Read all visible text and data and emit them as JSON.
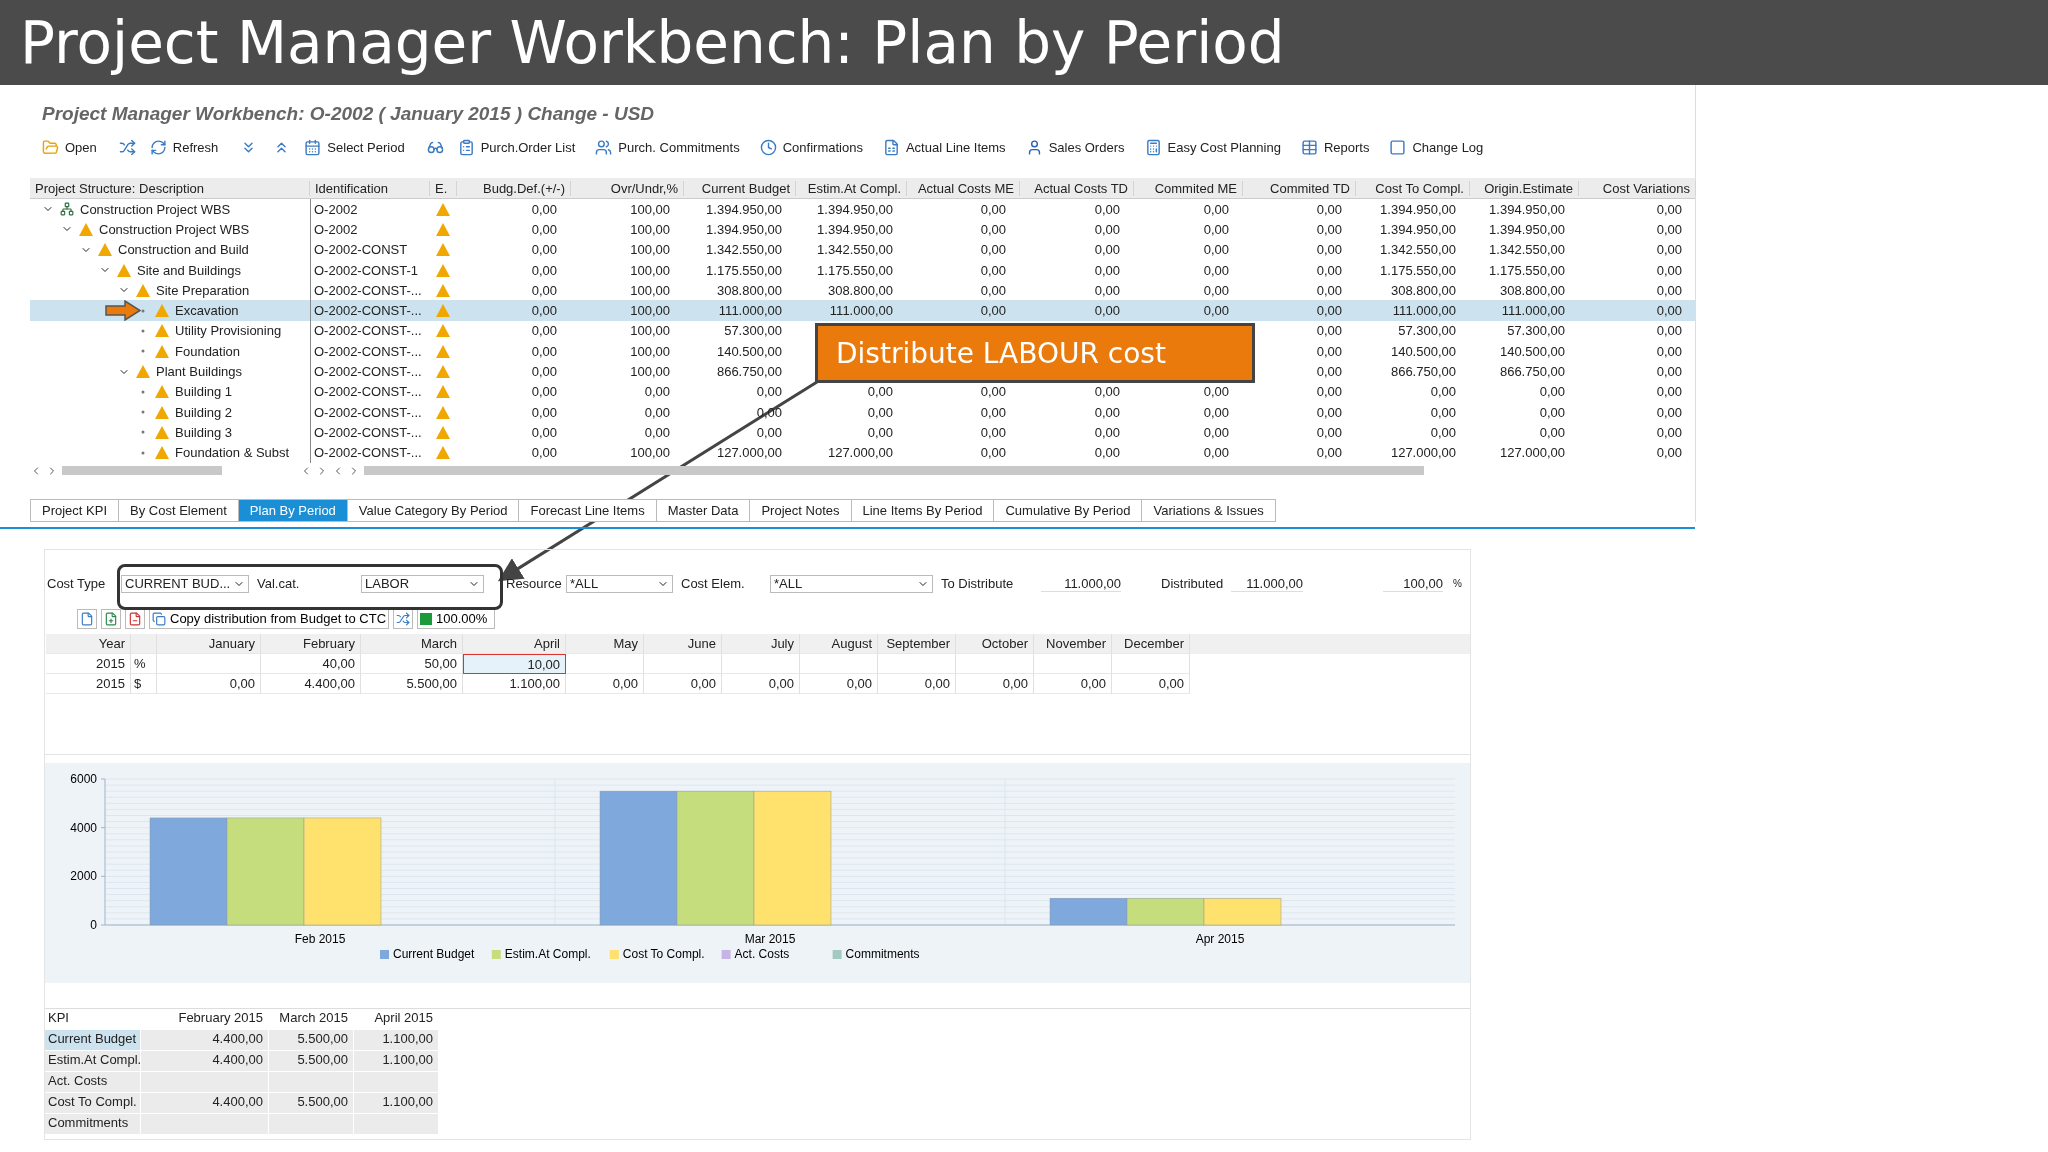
{
  "slide_title": "Project Manager Workbench: Plan by Period",
  "window": {
    "title": "Project Manager Workbench: O-2002 ( January 2015 ) Change - USD"
  },
  "toolbar": [
    {
      "kind": "button",
      "label": "Open"
    },
    {
      "kind": "icon"
    },
    {
      "kind": "button",
      "label": "Refresh"
    },
    {
      "kind": "icon"
    },
    {
      "kind": "icon"
    },
    {
      "kind": "button",
      "label": "Select Period"
    },
    {
      "kind": "icon"
    },
    {
      "kind": "button",
      "label": "Purch.Order List"
    },
    {
      "kind": "button",
      "label": "Purch. Commitments"
    },
    {
      "kind": "button",
      "label": "Confirmations"
    },
    {
      "kind": "button",
      "label": "Actual Line Items"
    },
    {
      "kind": "button",
      "label": "Sales Orders"
    },
    {
      "kind": "button",
      "label": "Easy Cost Planning"
    },
    {
      "kind": "button",
      "label": "Reports"
    },
    {
      "kind": "button",
      "label": "Change Log"
    }
  ],
  "tree": {
    "columns": [
      "Project Structure: Description",
      "Identification",
      "E.",
      "Budg.Def.(+/-)",
      "Ovr/Undr,%",
      "Current Budget",
      "Estim.At Compl.",
      "Actual Costs ME",
      "Actual Costs TD",
      "Commited ME",
      "Commited TD",
      "Cost To Compl.",
      "Origin.Estimate",
      "Cost Variations"
    ],
    "rows": [
      {
        "name": "Construction Project WBS",
        "kind": "project",
        "id": "O-2002",
        "selected": false,
        "expanded": true,
        "cells": {
          "budg_def": "0,00",
          "ovr_undr": "100,00",
          "current_budget": "1.394.950,00",
          "estim": "1.394.950,00",
          "act_me": "0,00",
          "act_td": "0,00",
          "com_me": "0,00",
          "com_td": "0,00",
          "ctc": "1.394.950,00",
          "origin": "1.394.950,00",
          "variations": "0,00"
        },
        "children": [
          {
            "name": "Construction Project WBS",
            "kind": "wbs",
            "id": "O-2002",
            "selected": false,
            "expanded": true,
            "cells": {
              "budg_def": "0,00",
              "ovr_undr": "100,00",
              "current_budget": "1.394.950,00",
              "estim": "1.394.950,00",
              "act_me": "0,00",
              "act_td": "0,00",
              "com_me": "0,00",
              "com_td": "0,00",
              "ctc": "1.394.950,00",
              "origin": "1.394.950,00",
              "variations": "0,00"
            },
            "children": [
              {
                "name": "Construction and Build",
                "kind": "wbs",
                "id": "O-2002-CONST",
                "selected": false,
                "expanded": true,
                "cells": {
                  "budg_def": "0,00",
                  "ovr_undr": "100,00",
                  "current_budget": "1.342.550,00",
                  "estim": "1.342.550,00",
                  "act_me": "0,00",
                  "act_td": "0,00",
                  "com_me": "0,00",
                  "com_td": "0,00",
                  "ctc": "1.342.550,00",
                  "origin": "1.342.550,00",
                  "variations": "0,00"
                },
                "children": [
                  {
                    "name": "Site and Buildings",
                    "kind": "wbs",
                    "id": "O-2002-CONST-1",
                    "selected": false,
                    "expanded": true,
                    "cells": {
                      "budg_def": "0,00",
                      "ovr_undr": "100,00",
                      "current_budget": "1.175.550,00",
                      "estim": "1.175.550,00",
                      "act_me": "0,00",
                      "act_td": "0,00",
                      "com_me": "0,00",
                      "com_td": "0,00",
                      "ctc": "1.175.550,00",
                      "origin": "1.175.550,00",
                      "variations": "0,00"
                    },
                    "children": [
                      {
                        "name": "Site Preparation",
                        "kind": "wbs",
                        "id": "O-2002-CONST-...",
                        "selected": false,
                        "expanded": true,
                        "cells": {
                          "budg_def": "0,00",
                          "ovr_undr": "100,00",
                          "current_budget": "308.800,00",
                          "estim": "308.800,00",
                          "act_me": "0,00",
                          "act_td": "0,00",
                          "com_me": "0,00",
                          "com_td": "0,00",
                          "ctc": "308.800,00",
                          "origin": "308.800,00",
                          "variations": "0,00"
                        },
                        "children": [
                          {
                            "name": "Excavation",
                            "kind": "wbs",
                            "id": "O-2002-CONST-...",
                            "selected": true,
                            "cells": {
                              "budg_def": "0,00",
                              "ovr_undr": "100,00",
                              "current_budget": "111.000,00",
                              "estim": "111.000,00",
                              "act_me": "0,00",
                              "act_td": "0,00",
                              "com_me": "0,00",
                              "com_td": "0,00",
                              "ctc": "111.000,00",
                              "origin": "111.000,00",
                              "variations": "0,00"
                            }
                          },
                          {
                            "name": "Utility Provisioning",
                            "kind": "wbs",
                            "id": "O-2002-CONST-...",
                            "selected": false,
                            "cells": {
                              "budg_def": "0,00",
                              "ovr_undr": "100,00",
                              "current_budget": "57.300,00",
                              "com_td": "0,00",
                              "ctc": "57.300,00",
                              "origin": "57.300,00",
                              "variations": "0,00"
                            }
                          },
                          {
                            "name": "Foundation",
                            "kind": "wbs",
                            "id": "O-2002-CONST-...",
                            "selected": false,
                            "cells": {
                              "budg_def": "0,00",
                              "ovr_undr": "100,00",
                              "current_budget": "140.500,00",
                              "com_td": "0,00",
                              "ctc": "140.500,00",
                              "origin": "140.500,00",
                              "variations": "0,00"
                            }
                          }
                        ]
                      },
                      {
                        "name": "Plant Buildings",
                        "kind": "wbs",
                        "id": "O-2002-CONST-...",
                        "selected": false,
                        "expanded": true,
                        "cells": {
                          "budg_def": "0,00",
                          "ovr_undr": "100,00",
                          "current_budget": "866.750,00",
                          "com_td": "0,00",
                          "ctc": "866.750,00",
                          "origin": "866.750,00",
                          "variations": "0,00"
                        },
                        "children": [
                          {
                            "name": "Building 1",
                            "kind": "wbs",
                            "id": "O-2002-CONST-...",
                            "selected": false,
                            "cells": {
                              "budg_def": "0,00",
                              "ovr_undr": "0,00",
                              "current_budget": "0,00",
                              "estim": "0,00",
                              "act_me": "0,00",
                              "act_td": "0,00",
                              "com_me": "0,00",
                              "com_td": "0,00",
                              "ctc": "0,00",
                              "origin": "0,00",
                              "variations": "0,00"
                            }
                          },
                          {
                            "name": "Building 2",
                            "kind": "wbs",
                            "id": "O-2002-CONST-...",
                            "selected": false,
                            "cells": {
                              "budg_def": "0,00",
                              "ovr_undr": "0,00",
                              "current_budget": "0,00",
                              "estim": "0,00",
                              "act_me": "0,00",
                              "act_td": "0,00",
                              "com_me": "0,00",
                              "com_td": "0,00",
                              "ctc": "0,00",
                              "origin": "0,00",
                              "variations": "0,00"
                            }
                          },
                          {
                            "name": "Building 3",
                            "kind": "wbs",
                            "id": "O-2002-CONST-...",
                            "selected": false,
                            "cells": {
                              "budg_def": "0,00",
                              "ovr_undr": "0,00",
                              "current_budget": "0,00",
                              "estim": "0,00",
                              "act_me": "0,00",
                              "act_td": "0,00",
                              "com_me": "0,00",
                              "com_td": "0,00",
                              "ctc": "0,00",
                              "origin": "0,00",
                              "variations": "0,00"
                            }
                          },
                          {
                            "name": "Foundation & Subst",
                            "kind": "wbs",
                            "id": "O-2002-CONST-...",
                            "selected": false,
                            "cells": {
                              "budg_def": "0,00",
                              "ovr_undr": "100,00",
                              "current_budget": "127.000,00",
                              "estim": "127.000,00",
                              "act_me": "0,00",
                              "act_td": "0,00",
                              "com_me": "0,00",
                              "com_td": "0,00",
                              "ctc": "127.000,00",
                              "origin": "127.000,00",
                              "variations": "0,00"
                            }
                          }
                        ]
                      }
                    ]
                  }
                ]
              }
            ]
          }
        ]
      }
    ]
  },
  "callout": {
    "text": "Distribute LABOUR cost"
  },
  "tabs": [
    {
      "label": "Project KPI",
      "selected": false
    },
    {
      "label": "By Cost Element",
      "selected": false
    },
    {
      "label": "Plan By Period",
      "selected": true
    },
    {
      "label": "Value Category By Period",
      "selected": false
    },
    {
      "label": "Forecast Line Items",
      "selected": false
    },
    {
      "label": "Master Data",
      "selected": false
    },
    {
      "label": "Project Notes",
      "selected": false
    },
    {
      "label": "Line Items By Period",
      "selected": false
    },
    {
      "label": "Cumulative By Period",
      "selected": false
    },
    {
      "label": "Variations & Issues",
      "selected": false
    }
  ],
  "filters": {
    "cost_type_label": "Cost Type",
    "cost_type": "CURRENT BUD...",
    "val_cat_label": "Val.cat.",
    "val_cat": "LABOR",
    "resource_label": "Resource",
    "resource": "*ALL",
    "cost_elem_label": "Cost Elem.",
    "cost_elem": "*ALL",
    "to_distribute_label": "To Distribute",
    "to_distribute": "11.000,00",
    "distributed_label": "Distributed",
    "distributed": "11.000,00",
    "percent": "100,00",
    "percent_unit": "%"
  },
  "distribution_toolbar": {
    "copy_button": "Copy distribution from Budget to CTC",
    "share": "100.00%"
  },
  "period_grid": {
    "columns": [
      {
        "kind": "text",
        "label": "Year"
      },
      {
        "kind": "unit"
      },
      {
        "kind": "month",
        "label": "January"
      },
      {
        "kind": "month",
        "label": "February"
      },
      {
        "kind": "month",
        "label": "March"
      },
      {
        "kind": "month",
        "label": "April"
      },
      {
        "kind": "month",
        "label": "May"
      },
      {
        "kind": "month",
        "label": "June"
      },
      {
        "kind": "month",
        "label": "July"
      },
      {
        "kind": "month",
        "label": "August"
      },
      {
        "kind": "month",
        "label": "September"
      },
      {
        "kind": "month",
        "label": "October"
      },
      {
        "kind": "month",
        "label": "November"
      },
      {
        "kind": "month",
        "label": "December"
      }
    ],
    "rows": [
      {
        "cells": [
          {
            "value": "2015",
            "editing": false
          },
          {
            "value": "%",
            "editing": false
          },
          {
            "editing": false
          },
          {
            "value": "40,00",
            "editing": false
          },
          {
            "value": "50,00",
            "editing": false
          },
          {
            "value": "10,00",
            "editing": true
          },
          {
            "editing": false
          },
          {
            "editing": false
          },
          {
            "editing": false
          },
          {
            "editing": false
          },
          {
            "editing": false
          },
          {
            "editing": false
          },
          {
            "editing": false
          },
          {
            "editing": false
          }
        ]
      },
      {
        "cells": [
          {
            "value": "2015",
            "editing": false
          },
          {
            "value": "$",
            "editing": false
          },
          {
            "value": "0,00",
            "editing": false
          },
          {
            "value": "4.400,00",
            "editing": false
          },
          {
            "value": "5.500,00",
            "editing": false
          },
          {
            "value": "1.100,00",
            "editing": false
          },
          {
            "value": "0,00",
            "editing": false
          },
          {
            "value": "0,00",
            "editing": false
          },
          {
            "value": "0,00",
            "editing": false
          },
          {
            "value": "0,00",
            "editing": false
          },
          {
            "value": "0,00",
            "editing": false
          },
          {
            "value": "0,00",
            "editing": false
          },
          {
            "value": "0,00",
            "editing": false
          },
          {
            "value": "0,00",
            "editing": false
          }
        ]
      }
    ]
  },
  "chart_data": {
    "type": "bar",
    "categories": [
      "Feb 2015",
      "Mar 2015",
      "Apr 2015"
    ],
    "ylim": [
      0,
      6000
    ],
    "yticks": [
      0,
      2000,
      4000,
      6000
    ],
    "legend": "bottom",
    "series": [
      {
        "name": "Current Budget",
        "color": "#7fa8dc",
        "values": [
          4400,
          5500,
          1100
        ]
      },
      {
        "name": "Estim.At Compl.",
        "color": "#c6dd7d",
        "values": [
          4400,
          5500,
          1100
        ]
      },
      {
        "name": "Cost To Compl.",
        "color": "#ffe16e",
        "values": [
          4400,
          5500,
          1100
        ]
      },
      {
        "name": "Act. Costs",
        "color": "#c7b3e6",
        "values": [
          null,
          null,
          null
        ]
      },
      {
        "name": "Commitments",
        "color": "#a3c9c0",
        "values": [
          null,
          null,
          null
        ]
      }
    ]
  },
  "kpi_table": {
    "columns": [
      "KPI",
      "February 2015",
      "March 2015",
      "April 2015"
    ],
    "rows": [
      {
        "label": "Current Budget",
        "selected": true,
        "values": [
          "4.400,00",
          "5.500,00",
          "1.100,00"
        ]
      },
      {
        "label": "Estim.At Compl.",
        "selected": false,
        "values": [
          "4.400,00",
          "5.500,00",
          "1.100,00"
        ]
      },
      {
        "label": "Act. Costs",
        "selected": false
      },
      {
        "label": "Cost To Compl.",
        "selected": false,
        "values": [
          "4.400,00",
          "5.500,00",
          "1.100,00"
        ]
      },
      {
        "label": "Commitments",
        "selected": false
      }
    ]
  }
}
